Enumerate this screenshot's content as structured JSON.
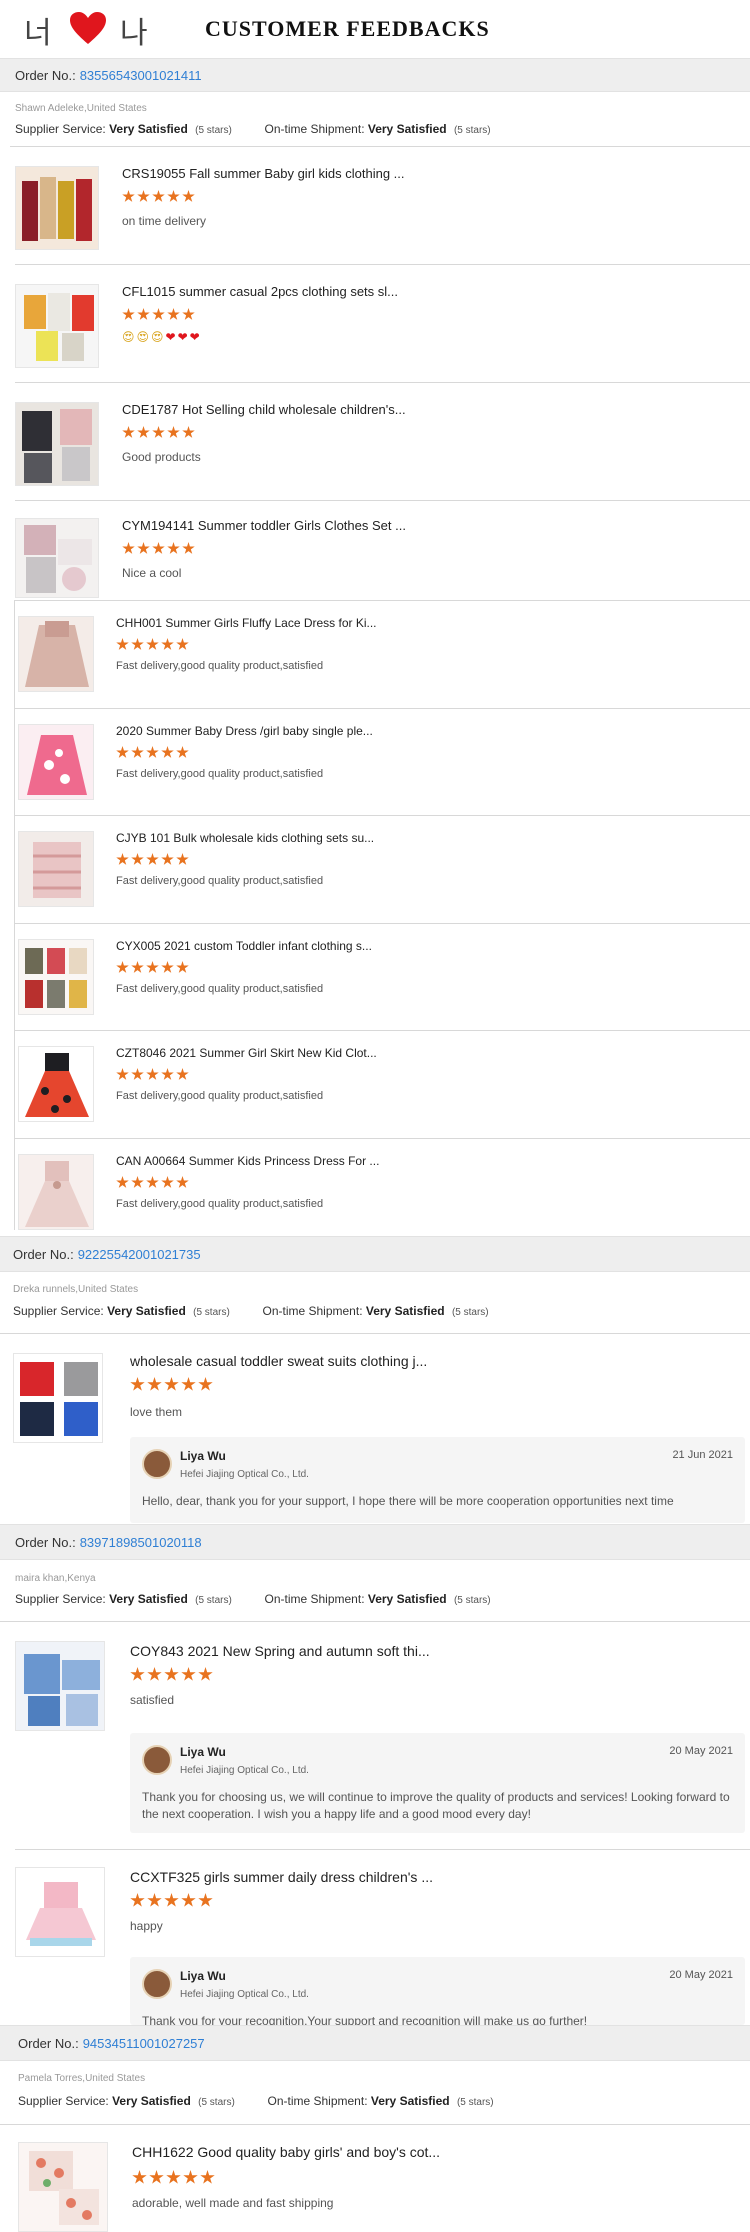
{
  "banner": {
    "korean_left": "너",
    "korean_right": "나",
    "title": "CUSTOMER FEEDBACKS"
  },
  "labels": {
    "order_no": "Order No.:",
    "supplier_service": "Supplier Service:",
    "ontime_shipment": "On-time Shipment:"
  },
  "orders": [
    {
      "number": "83556543001021411",
      "buyer": "Shawn Adeleke,United States",
      "supplier_rating": "Very Satisfied",
      "supplier_stars": "(5 stars)",
      "shipment_rating": "Very Satisfied",
      "shipment_stars": "(5 stars)",
      "items": [
        {
          "title": "CRS19055 Fall summer Baby girl kids clothing ...",
          "stars": 5,
          "comment": "on time delivery"
        },
        {
          "title": "CFL1015 summer casual 2pcs clothing sets sl...",
          "stars": 5,
          "comment": "",
          "emoji": [
            "😍",
            "😍",
            "😍",
            "❤",
            "❤",
            "❤"
          ]
        },
        {
          "title": "CDE1787 Hot Selling child wholesale children's...",
          "stars": 5,
          "comment": "Good products"
        },
        {
          "title": "CYM194141 Summer toddler Girls Clothes Set ...",
          "stars": 5,
          "comment": "Nice a cool"
        },
        {
          "title": "CHH001 Summer Girls Fluffy Lace Dress for Ki...",
          "stars": 5,
          "comment": "Fast delivery,good quality product,satisfied"
        },
        {
          "title": "2020 Summer Baby Dress /girl baby single ple...",
          "stars": 5,
          "comment": "Fast delivery,good quality product,satisfied"
        },
        {
          "title": "CJYB 101 Bulk wholesale kids clothing sets su...",
          "stars": 5,
          "comment": "Fast delivery,good quality product,satisfied"
        },
        {
          "title": "CYX005 2021 custom Toddler infant clothing s...",
          "stars": 5,
          "comment": "Fast delivery,good quality product,satisfied"
        },
        {
          "title": "CZT8046 2021 Summer Girl Skirt New Kid Clot...",
          "stars": 5,
          "comment": "Fast delivery,good quality product,satisfied"
        },
        {
          "title": "CAN A00664 Summer Kids Princess Dress For ...",
          "stars": 5,
          "comment": "Fast delivery,good quality product,satisfied"
        }
      ]
    },
    {
      "number": "92225542001021735",
      "buyer": "Dreka runnels,United States",
      "supplier_rating": "Very Satisfied",
      "supplier_stars": "(5 stars)",
      "shipment_rating": "Very Satisfied",
      "shipment_stars": "(5 stars)",
      "items": [
        {
          "title": "wholesale casual toddler sweat suits clothing j...",
          "stars": 5,
          "comment": "love them",
          "reply": {
            "name": "Liya Wu",
            "company": "Hefei Jiajing Optical Co., Ltd.",
            "date": "21 Jun 2021",
            "message": "Hello, dear, thank you for your support, I hope there will be more cooperation opportunities next time"
          }
        }
      ]
    },
    {
      "number": "83971898501020118",
      "buyer": "maira khan,Kenya",
      "supplier_rating": "Very Satisfied",
      "supplier_stars": "(5 stars)",
      "shipment_rating": "Very Satisfied",
      "shipment_stars": "(5 stars)",
      "items": [
        {
          "title": "COY843 2021 New Spring and autumn soft thi...",
          "stars": 5,
          "comment": "satisfied",
          "reply": {
            "name": "Liya Wu",
            "company": "Hefei Jiajing Optical Co., Ltd.",
            "date": "20 May 2021",
            "message": "Thank you for choosing us, we will continue to improve the quality of products and services! Looking forward to the next cooperation. I wish you a happy life and a good mood every day!"
          }
        },
        {
          "title": "CCXTF325 girls summer daily dress children's ...",
          "stars": 5,
          "comment": "happy",
          "reply": {
            "name": "Liya Wu",
            "company": "Hefei Jiajing Optical Co., Ltd.",
            "date": "20 May 2021",
            "message": "Thank you for your recognition.Your support and recognition will make us go further!"
          }
        }
      ]
    },
    {
      "number": "94534511001027257",
      "buyer": "Pamela Torres,United States",
      "supplier_rating": "Very Satisfied",
      "supplier_stars": "(5 stars)",
      "shipment_rating": "Very Satisfied",
      "shipment_stars": "(5 stars)",
      "items": [
        {
          "title": "CHH1622 Good quality baby girls' and boy's cot...",
          "stars": 5,
          "comment": "adorable, well made and fast shipping"
        }
      ]
    }
  ],
  "colors": {
    "star": "#e8731f",
    "order_link": "#2f7fd4",
    "order_bar": "#eeeeee"
  }
}
